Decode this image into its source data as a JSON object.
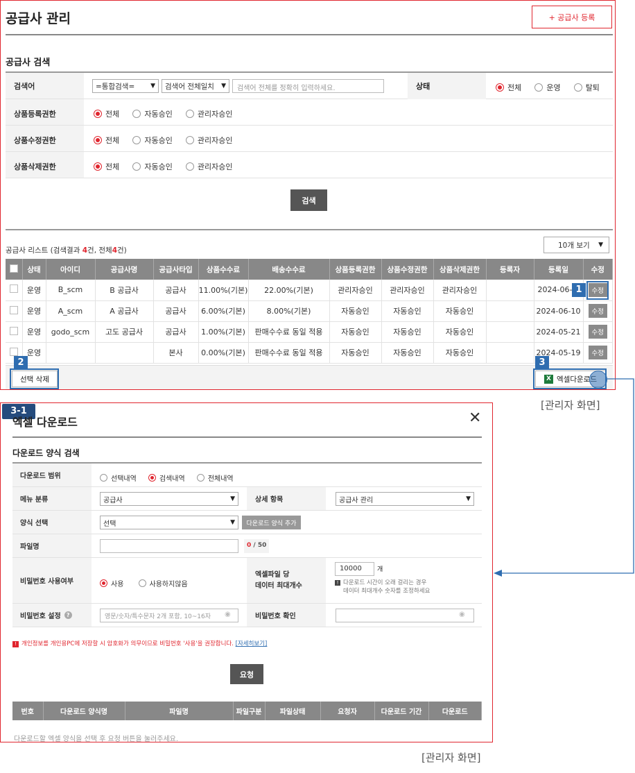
{
  "page": {
    "title": "공급사 관리",
    "register_button": "+ 공급사 등록",
    "caption": "[관리자 화면]",
    "caption2": "[관리자 화면]"
  },
  "search": {
    "section_title": "공급사 검색",
    "keyword": {
      "label": "검색어",
      "type_select": "=통합검색=",
      "match_select": "검색어 전체일치",
      "placeholder": "검색어 전체를 정확히 입력하세요."
    },
    "status": {
      "label": "상태",
      "options": [
        "전체",
        "운영",
        "탈퇴"
      ],
      "selected": "전체"
    },
    "register_perm": {
      "label": "상품등록권한",
      "options": [
        "전체",
        "자동승인",
        "관리자승인"
      ]
    },
    "modify_perm": {
      "label": "상품수정권한",
      "options": [
        "전체",
        "자동승인",
        "관리자승인"
      ]
    },
    "delete_perm": {
      "label": "상품삭제권한",
      "options": [
        "전체",
        "자동승인",
        "관리자승인"
      ]
    },
    "search_button": "검색"
  },
  "list": {
    "summary_prefix": "공급사 리스트 (검색결과 ",
    "count_result": "4",
    "summary_mid": "건, 전체",
    "count_total": "4",
    "summary_suffix": "건)",
    "page_size": "10개 보기",
    "headers": [
      "상태",
      "아이디",
      "공급사명",
      "공급사타입",
      "상품수수료",
      "배송수수료",
      "상품등록권한",
      "상품수정권한",
      "상품삭제권한",
      "등록자",
      "등록일",
      "수정"
    ],
    "rows": [
      {
        "status": "운영",
        "id": "B_scm",
        "name": "B 공급사",
        "type": "공급사",
        "fee": "11.00%(기본)",
        "ship": "22.00%(기본)",
        "reg": "관리자승인",
        "mod": "관리자승인",
        "del": "관리자승인",
        "by": "",
        "date": "2024-06-",
        "edit": "수정"
      },
      {
        "status": "운영",
        "id": "A_scm",
        "name": "A 공급사",
        "type": "공급사",
        "fee": "6.00%(기본)",
        "ship": "8.00%(기본)",
        "reg": "자동승인",
        "mod": "자동승인",
        "del": "자동승인",
        "by": "",
        "date": "2024-06-10",
        "edit": "수정"
      },
      {
        "status": "운영",
        "id": "godo_scm",
        "name": "고도 공급사",
        "type": "공급사",
        "fee": "1.00%(기본)",
        "ship": "판매수수료 동일 적용",
        "reg": "자동승인",
        "mod": "자동승인",
        "del": "자동승인",
        "by": "",
        "date": "2024-05-21",
        "edit": "수정"
      },
      {
        "status": "운영",
        "id": "",
        "name": "",
        "type": "본사",
        "fee": "0.00%(기본)",
        "ship": "판매수수료 동일 적용",
        "reg": "자동승인",
        "mod": "자동승인",
        "del": "자동승인",
        "by": "",
        "date": "2024-05-19",
        "edit": "수정"
      }
    ],
    "delete_button": "선택 삭제",
    "excel_button": "엑셀다운로드",
    "excel_icon": "excel-icon"
  },
  "badges": {
    "b1": "1",
    "b2": "2",
    "b3": "3",
    "b31": "3-1"
  },
  "modal": {
    "title": "엑셀 다운로드",
    "close": "✕",
    "section": "다운로드 양식 검색",
    "range": {
      "label": "다운로드 범위",
      "options": [
        "선택내역",
        "검색내역",
        "전체내역"
      ]
    },
    "menu": {
      "label": "메뉴 분류",
      "value": "공급사"
    },
    "detail": {
      "label": "상세 항목",
      "value": "공급사 관리"
    },
    "form": {
      "label": "양식 선택",
      "value": "선택",
      "add_button": "다운로드 양식 추가"
    },
    "filename": {
      "label": "파일명",
      "counter": "0",
      "counter_max": " / 50"
    },
    "password_use": {
      "label": "비밀번호 사용여부",
      "options": [
        "사용",
        "사용하지않음"
      ]
    },
    "max_rows": {
      "label1": "엑셀파일 당",
      "label2": "데이터 최대개수",
      "value": "10000",
      "unit": "개",
      "note1": "다운로드 시간이 오래 걸리는 경우",
      "note2": "데이터 최대개수 숫자를 조정하세요"
    },
    "password_set": {
      "label": "비밀번호 설정",
      "placeholder": "영문/숫자/특수문자 2개 포함, 10~16자"
    },
    "password_confirm": {
      "label": "비밀번호 확인"
    },
    "warning": "개인정보를 개인용PC에 저장할 시 암호화가 의무이므로 비밀번호 '사용'을 권장합니다.",
    "warning_link": "[자세히보기]",
    "request_button": "요청",
    "table_headers": [
      "번호",
      "다운로드 양식명",
      "파일명",
      "파일구분",
      "파일상태",
      "요청자",
      "다운로드 기간",
      "다운로드"
    ],
    "empty_text": "다운로드할 엑셀 양식을 선택 후 요청 버튼을 눌러주세요."
  }
}
